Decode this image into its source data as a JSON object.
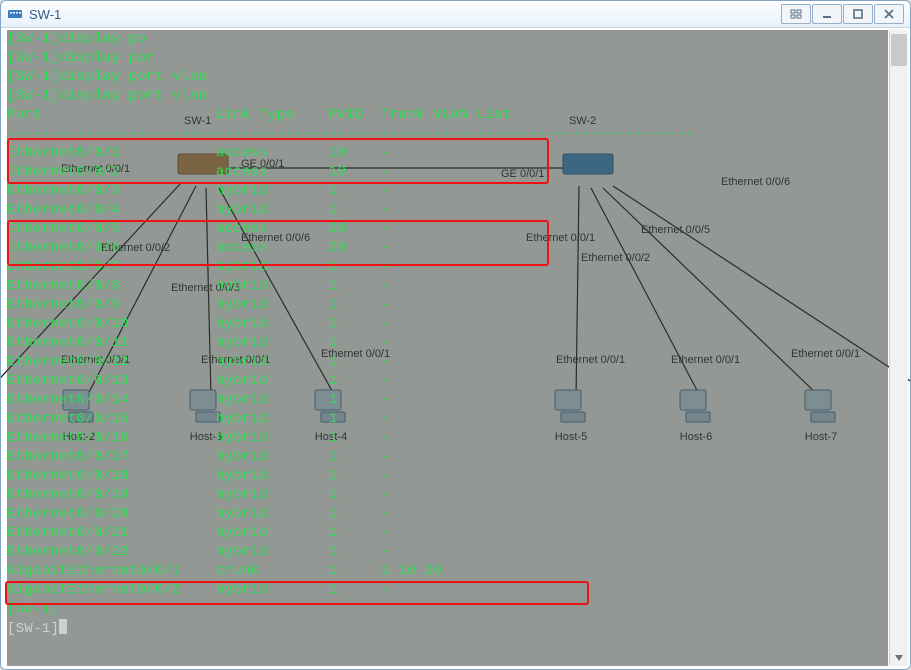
{
  "window": {
    "title": "SW-1"
  },
  "terminal": {
    "pre_lines": [
      "[SW-1]display po",
      "[SW-1]display por",
      "[SW-1]display port vlan",
      "[SW-1]display port vlan"
    ],
    "header": "Port                    Link Type    PVID  Trunk VLAN List",
    "dashline": "-------------------------------------------------------------------------------",
    "rows": [
      {
        "port": "Ethernet0/0/1",
        "type": "access",
        "pvid": "10",
        "vlans": "-"
      },
      {
        "port": "Ethernet0/0/2",
        "type": "access",
        "pvid": "10",
        "vlans": "-"
      },
      {
        "port": "Ethernet0/0/3",
        "type": "hybrid",
        "pvid": "1",
        "vlans": "-"
      },
      {
        "port": "Ethernet0/0/4",
        "type": "hybrid",
        "pvid": "1",
        "vlans": "-"
      },
      {
        "port": "Ethernet0/0/5",
        "type": "access",
        "pvid": "20",
        "vlans": "-"
      },
      {
        "port": "Ethernet0/0/6",
        "type": "access",
        "pvid": "20",
        "vlans": "-"
      },
      {
        "port": "Ethernet0/0/7",
        "type": "hybrid",
        "pvid": "1",
        "vlans": "-"
      },
      {
        "port": "Ethernet0/0/8",
        "type": "hybrid",
        "pvid": "1",
        "vlans": "-"
      },
      {
        "port": "Ethernet0/0/9",
        "type": "hybrid",
        "pvid": "1",
        "vlans": "-"
      },
      {
        "port": "Ethernet0/0/10",
        "type": "hybrid",
        "pvid": "1",
        "vlans": "-"
      },
      {
        "port": "Ethernet0/0/11",
        "type": "hybrid",
        "pvid": "1",
        "vlans": "-"
      },
      {
        "port": "Ethernet0/0/12",
        "type": "hybrid",
        "pvid": "1",
        "vlans": "-"
      },
      {
        "port": "Ethernet0/0/13",
        "type": "hybrid",
        "pvid": "1",
        "vlans": "-"
      },
      {
        "port": "Ethernet0/0/14",
        "type": "hybrid",
        "pvid": "1",
        "vlans": "-"
      },
      {
        "port": "Ethernet0/0/15",
        "type": "hybrid",
        "pvid": "1",
        "vlans": "-"
      },
      {
        "port": "Ethernet0/0/16",
        "type": "hybrid",
        "pvid": "1",
        "vlans": "-"
      },
      {
        "port": "Ethernet0/0/17",
        "type": "hybrid",
        "pvid": "1",
        "vlans": "-"
      },
      {
        "port": "Ethernet0/0/18",
        "type": "hybrid",
        "pvid": "1",
        "vlans": "-"
      },
      {
        "port": "Ethernet0/0/19",
        "type": "hybrid",
        "pvid": "1",
        "vlans": "-"
      },
      {
        "port": "Ethernet0/0/20",
        "type": "hybrid",
        "pvid": "1",
        "vlans": "-"
      },
      {
        "port": "Ethernet0/0/21",
        "type": "hybrid",
        "pvid": "1",
        "vlans": "-"
      },
      {
        "port": "Ethernet0/0/22",
        "type": "hybrid",
        "pvid": "1",
        "vlans": "-"
      },
      {
        "port": "GigabitEthernet0/0/1",
        "type": "trunk",
        "pvid": "1",
        "vlans": "1 10 20"
      },
      {
        "port": "GigabitEthernet0/0/2",
        "type": "hybrid",
        "pvid": "1",
        "vlans": "-"
      }
    ],
    "post_lines": [
      "[SW-1]",
      "[SW-1]"
    ]
  },
  "topology": {
    "sw1": {
      "label": "SW-1",
      "portlabel": "GE 0/0/1"
    },
    "sw2": {
      "label": "SW-2",
      "portlabel": "GE 0/0/1"
    },
    "port_labels": {
      "sw1_e1": "Ethernet 0/0/1",
      "sw1_e2": "Ethernet 0/0/2",
      "sw1_e5": "Ethernet 0/0/5",
      "sw1_e6": "Ethernet 0/0/6",
      "sw2_e1": "Ethernet 0/0/1",
      "sw2_e2": "Ethernet 0/0/2",
      "sw2_e5": "Ethernet 0/0/5",
      "sw2_e6": "Ethernet 0/0/6",
      "host_eth": "Ethernet 0/0/1"
    },
    "hosts": {
      "h2": "Host-2",
      "h3": "Host-3",
      "h4": "Host-4",
      "h5": "Host-5",
      "h6": "Host-6",
      "h7": "Host-7"
    }
  }
}
